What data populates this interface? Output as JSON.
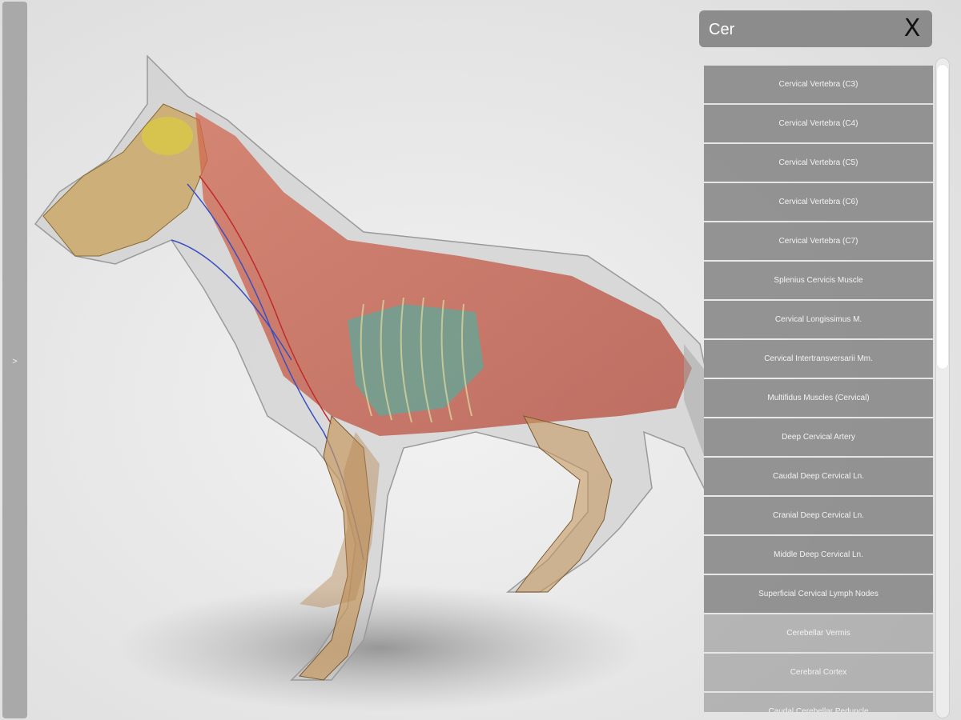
{
  "sidebar": {
    "toggle_label": ">"
  },
  "search": {
    "query": "Cer",
    "clear_label": "X"
  },
  "results": [
    "Cervical Vertebra (C3)",
    "Cervical Vertebra (C4)",
    "Cervical Vertebra (C5)",
    "Cervical Vertebra (C6)",
    "Cervical Vertebra (C7)",
    "Splenius Cervicis Muscle",
    "Cervical Longissimus M.",
    "Cervical Intertransversarii Mm.",
    "Multifidus Muscles (Cervical)",
    "Deep Cervical Artery",
    "Caudal Deep Cervical Ln.",
    "Cranial Deep Cervical Ln.",
    "Middle Deep Cervical Ln.",
    "Superficial Cervical Lymph Nodes",
    "Cerebellar Vermis",
    "Cerebral Cortex",
    "Caudal Cerebellar Peduncle"
  ],
  "viewport": {
    "model": "dog-anatomy-3d-model"
  },
  "colors": {
    "panel": "#8c8c8c",
    "rail": "#a9a9a9",
    "muscle": "#c8553f",
    "skin": "#bcbcbc",
    "lung": "#5fa89a",
    "brain": "#d8c64a"
  }
}
